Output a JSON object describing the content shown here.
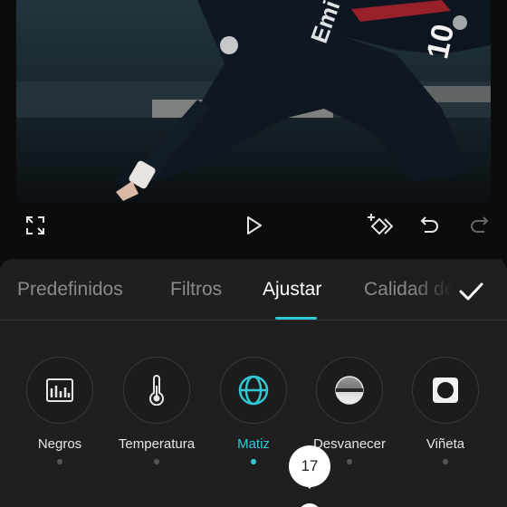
{
  "tabs": [
    "Predefinidos",
    "Filtros",
    "Ajustar",
    "Calidad de"
  ],
  "active_tab": "Ajustar",
  "adjust_tools": [
    {
      "label": "Negros",
      "icon": "blacks-icon"
    },
    {
      "label": "Temperatura",
      "icon": "thermometer-icon"
    },
    {
      "label": "Matiz",
      "icon": "tint-icon"
    },
    {
      "label": "Desvanecer",
      "icon": "fade-icon"
    },
    {
      "label": "Viñeta",
      "icon": "vignette-icon"
    }
  ],
  "active_tool": "Matiz",
  "slider": {
    "value": "17"
  },
  "preview": {
    "jersey_number": "10",
    "jersey_text": "Emi"
  },
  "colors": {
    "accent": "#33c7d6",
    "panel_bg": "#1f1f1f",
    "app_bg": "#0c0c0c"
  },
  "icons": {
    "fullscreen": "expand-icon",
    "play": "play-icon",
    "keyframe": "add-keyframe-icon",
    "undo": "undo-icon",
    "redo": "redo-icon",
    "confirm": "checkmark-icon"
  }
}
